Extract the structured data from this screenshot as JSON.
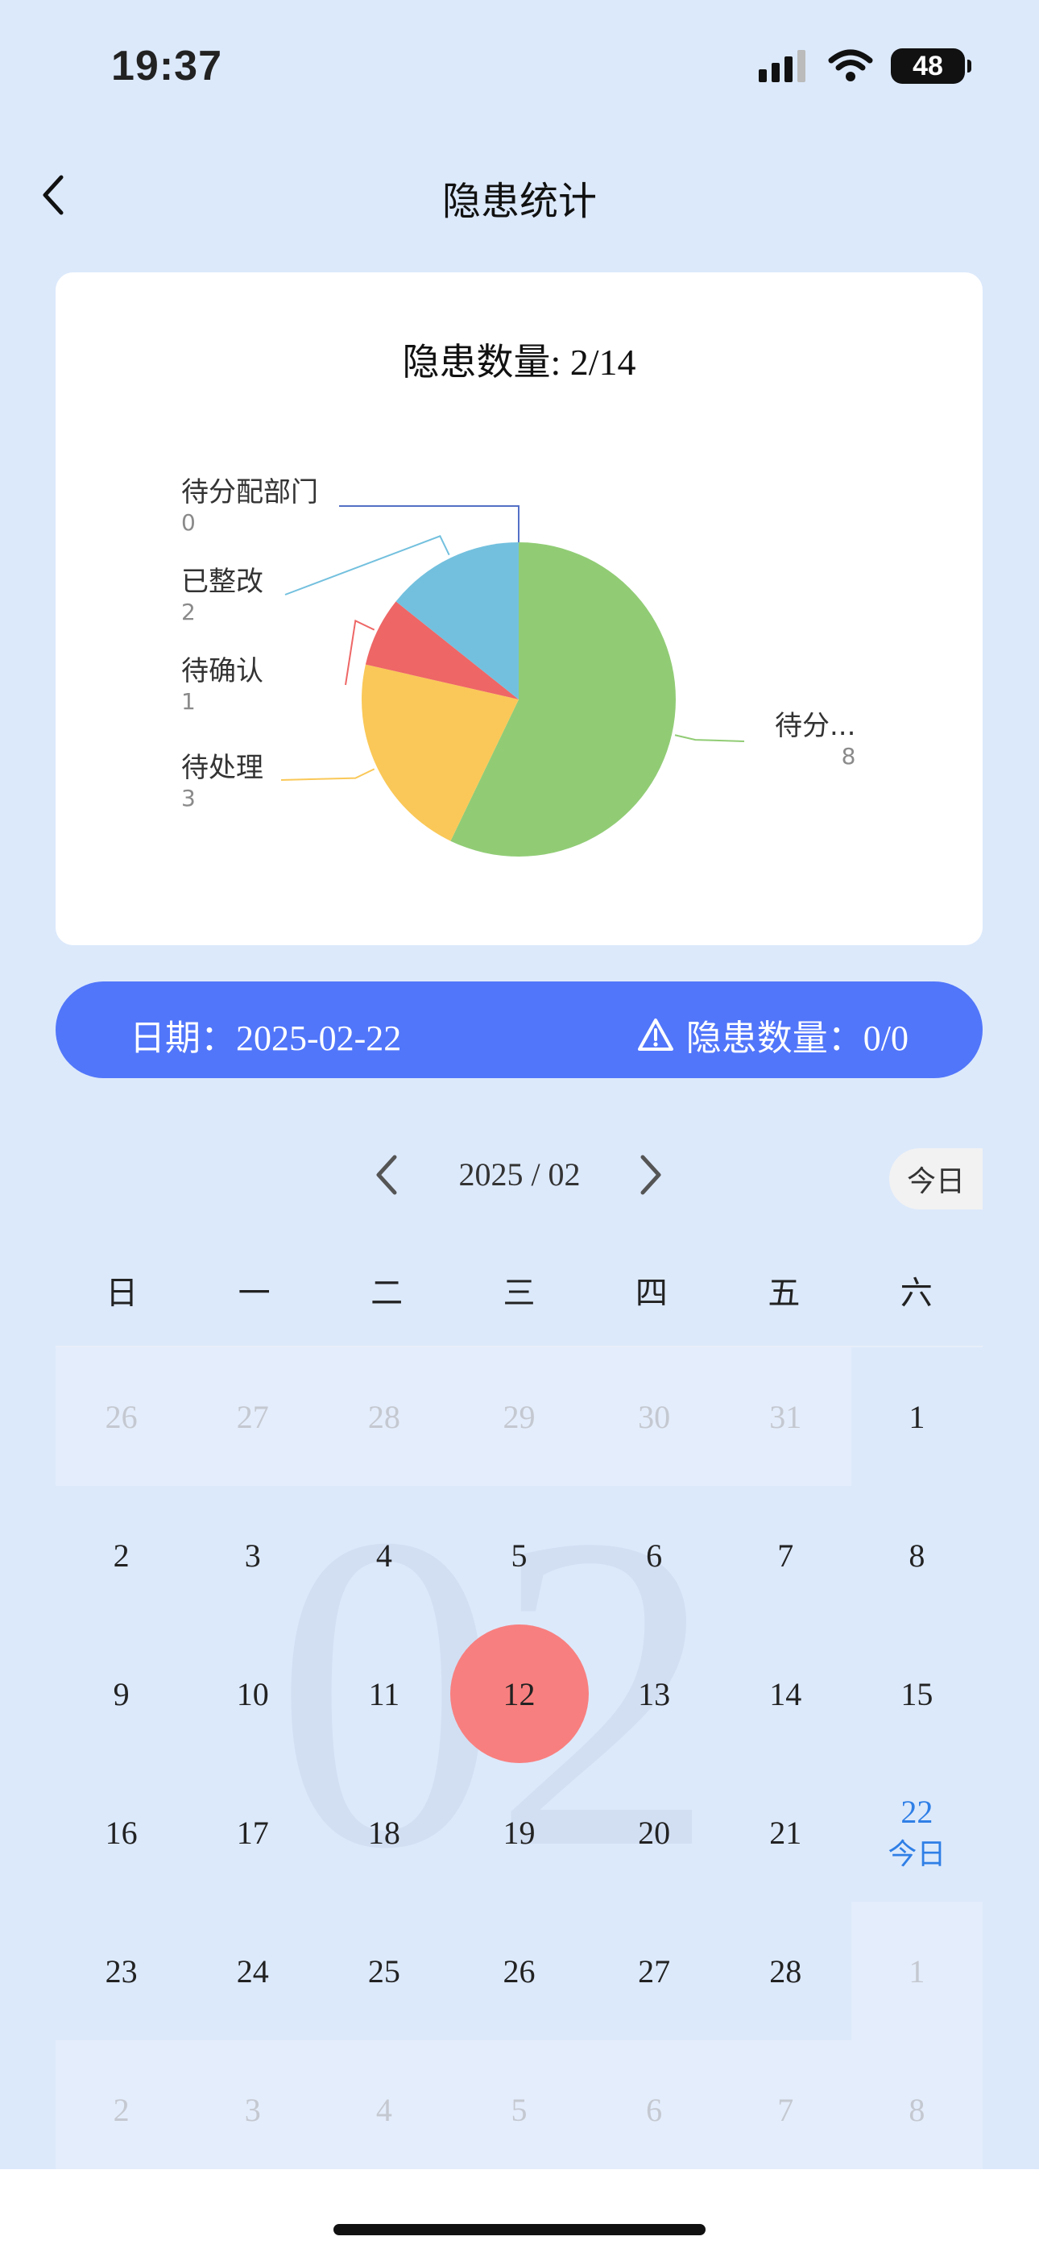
{
  "status": {
    "time": "19:37",
    "battery": "48"
  },
  "nav": {
    "title": "隐患统计"
  },
  "summary_card": {
    "title": "隐患数量: 2/14",
    "pie": {
      "segments": [
        {
          "label": "待分...",
          "value": "8",
          "color": "#91cc75"
        },
        {
          "label": "待处理",
          "value": "3",
          "color": "#fac858"
        },
        {
          "label": "待确认",
          "value": "1",
          "color": "#ee6666"
        },
        {
          "label": "已整改",
          "value": "2",
          "color": "#73c0de"
        },
        {
          "label": "待分配部门",
          "value": "0",
          "color": "#5470c6"
        }
      ]
    }
  },
  "date_bar": {
    "date_label": "日期：2025-02-22",
    "count_label": "隐患数量：0/0"
  },
  "calendar": {
    "month_label": "2025 / 02",
    "today_button": "今日",
    "watermark": "02",
    "weekdays": [
      "日",
      "一",
      "二",
      "三",
      "四",
      "五",
      "六"
    ],
    "today_tag": "今日",
    "days": [
      {
        "d": "26",
        "other": true
      },
      {
        "d": "27",
        "other": true
      },
      {
        "d": "28",
        "other": true
      },
      {
        "d": "29",
        "other": true
      },
      {
        "d": "30",
        "other": true
      },
      {
        "d": "31",
        "other": true
      },
      {
        "d": "1"
      },
      {
        "d": "2"
      },
      {
        "d": "3"
      },
      {
        "d": "4"
      },
      {
        "d": "5"
      },
      {
        "d": "6"
      },
      {
        "d": "7"
      },
      {
        "d": "8"
      },
      {
        "d": "9"
      },
      {
        "d": "10"
      },
      {
        "d": "11"
      },
      {
        "d": "12",
        "selected": true
      },
      {
        "d": "13"
      },
      {
        "d": "14"
      },
      {
        "d": "15"
      },
      {
        "d": "16"
      },
      {
        "d": "17"
      },
      {
        "d": "18"
      },
      {
        "d": "19"
      },
      {
        "d": "20"
      },
      {
        "d": "21"
      },
      {
        "d": "22",
        "today": true
      },
      {
        "d": "23"
      },
      {
        "d": "24"
      },
      {
        "d": "25"
      },
      {
        "d": "26"
      },
      {
        "d": "27"
      },
      {
        "d": "28"
      },
      {
        "d": "1",
        "other": true
      },
      {
        "d": "2",
        "other": true
      },
      {
        "d": "3",
        "other": true
      },
      {
        "d": "4",
        "other": true
      },
      {
        "d": "5",
        "other": true
      },
      {
        "d": "6",
        "other": true
      },
      {
        "d": "7",
        "other": true
      },
      {
        "d": "8",
        "other": true
      }
    ]
  }
}
